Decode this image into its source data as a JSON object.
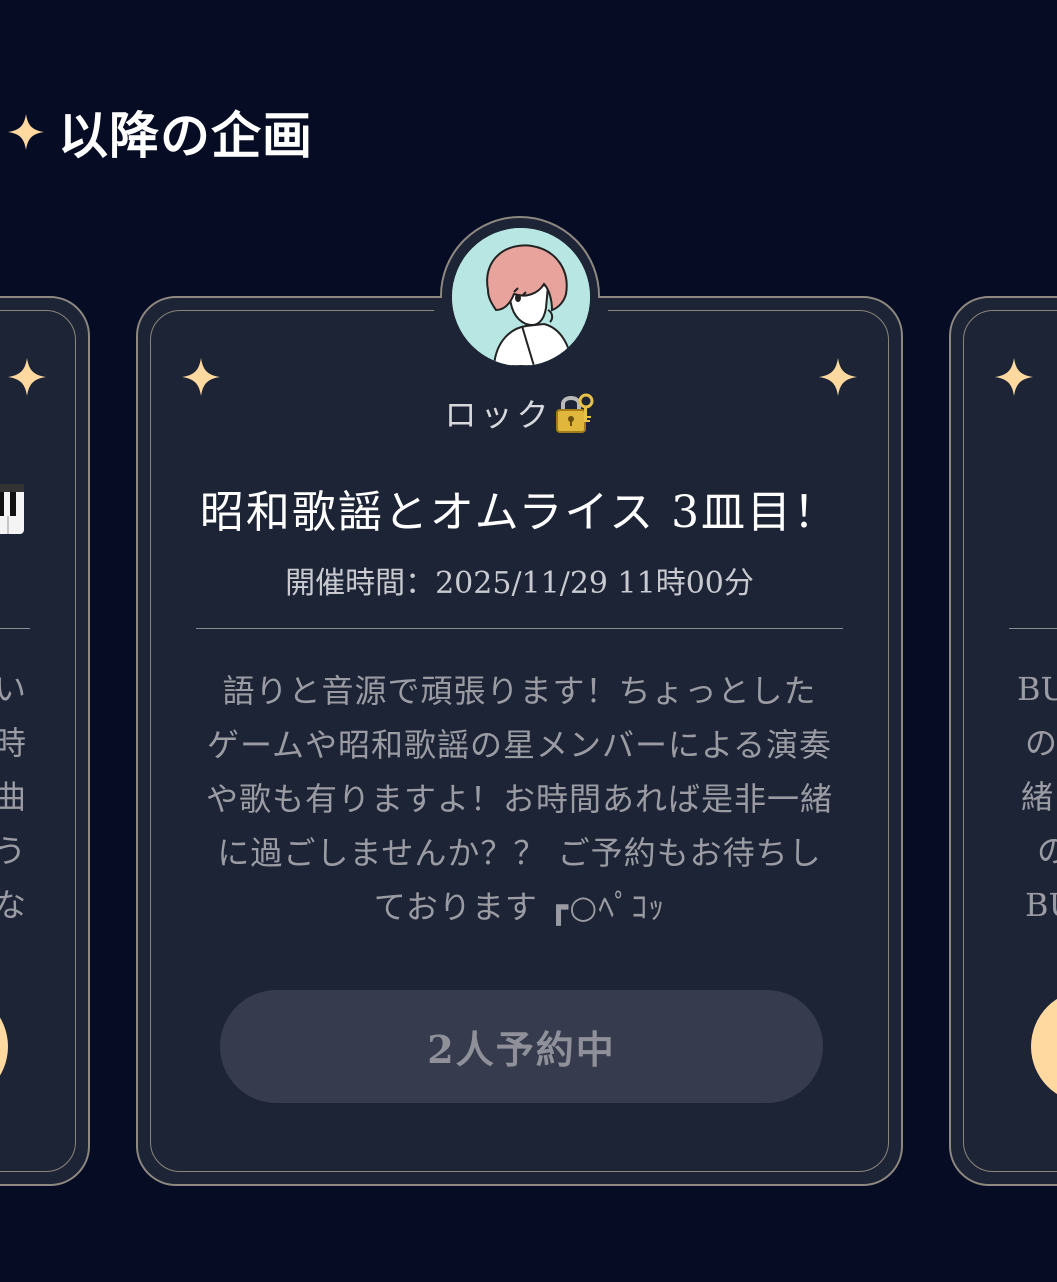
{
  "section": {
    "title": "以降の企画"
  },
  "main_card": {
    "host": "ロック",
    "host_icon": "lock-with-key-icon",
    "title": "昭和歌謡とオムライス 3皿目！",
    "time_label": "開催時間：",
    "time_value": "2025/11/29 11時00分",
    "description_lines": [
      "語りと音源で頑張ります！ちょっとした",
      "ゲームや昭和歌謡の星メンバーによる演奏",
      "や歌も有りますよ！お時間あれば是非一緒",
      "に過ごしませんか？？ ご予約もお待ちし",
      "ております ┏○ﾍﾟｺｯ"
    ],
    "button_label": "2人予約中"
  },
  "left_card": {
    "icon": "piano-icon",
    "text_lines": [
      "い",
      "時",
      "曲",
      "う",
      "な"
    ]
  },
  "right_card": {
    "text_lines": [
      "BU",
      "の",
      "緒",
      "の",
      "BU"
    ]
  },
  "colors": {
    "background": "#050c24",
    "card": "#1d2436",
    "accent": "#ffd9a0",
    "button_disabled": "#363c4d"
  }
}
